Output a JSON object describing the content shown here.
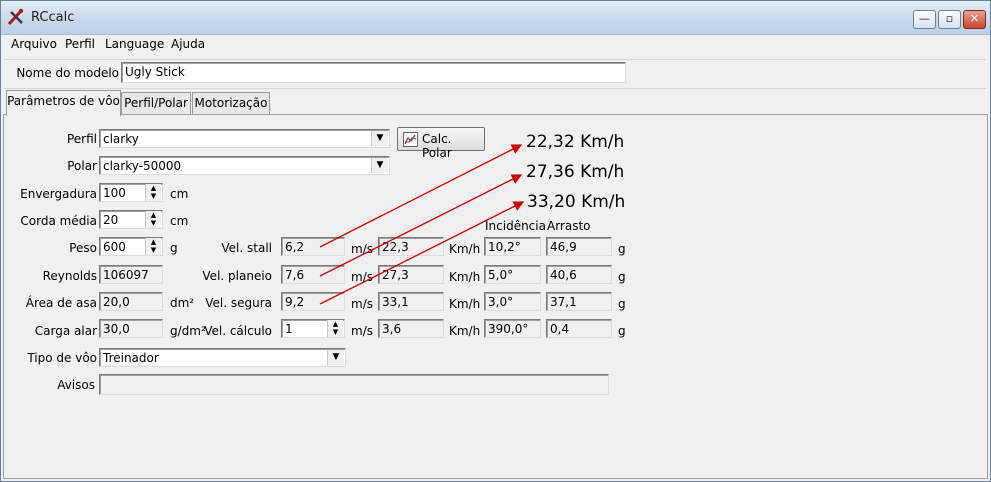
{
  "window": {
    "title": "RCcalc",
    "controls": {
      "minimize": "—",
      "maximize": "▫",
      "close": "✕"
    }
  },
  "menu": [
    "Arquivo",
    "Perfil",
    "Language",
    "Ajuda"
  ],
  "model": {
    "label": "Nome do modelo",
    "value": "Ugly Stick"
  },
  "tabs": [
    "Parâmetros de vôo",
    "Perfil/Polar",
    "Motorização"
  ],
  "form": {
    "perfil": {
      "label": "Perfil",
      "value": "clarky"
    },
    "polar": {
      "label": "Polar",
      "value": "clarky-50000"
    },
    "calc_polar_button": "Calc. Polar",
    "envergadura": {
      "label": "Envergadura",
      "value": "100",
      "unit": "cm"
    },
    "corda_media": {
      "label": "Corda média",
      "value": "20",
      "unit": "cm"
    },
    "peso": {
      "label": "Peso",
      "value": "600",
      "unit": "g"
    },
    "reynolds": {
      "label": "Reynolds",
      "value": "106097"
    },
    "area_asa": {
      "label": "Área de asa",
      "value": "20,0",
      "unit": "dm²"
    },
    "carga_alar": {
      "label": "Carga alar",
      "value": "30,0",
      "unit": "g/dm²"
    },
    "tipo_voo": {
      "label": "Tipo de vôo",
      "value": "Treinador"
    },
    "avisos": {
      "label": "Avisos",
      "value": ""
    }
  },
  "velocities": {
    "headers": {
      "incidencia": "Incidência",
      "arrasto": "Arrasto"
    },
    "units": {
      "ms": "m/s",
      "kmh": "Km/h",
      "g": "g"
    },
    "rows": [
      {
        "label": "Vel. stall",
        "ms": "6,2",
        "kmh": "22,3",
        "incidencia": "10,2°",
        "arrasto": "46,9"
      },
      {
        "label": "Vel. planeio",
        "ms": "7,6",
        "kmh": "27,3",
        "incidencia": "5,0°",
        "arrasto": "40,6"
      },
      {
        "label": "Vel. segura",
        "ms": "9,2",
        "kmh": "33,1",
        "incidencia": "3,0°",
        "arrasto": "37,1"
      },
      {
        "label": "Vel. cálculo",
        "ms": "1",
        "kmh": "3,6",
        "incidencia": "390,0°",
        "arrasto": "0,4"
      }
    ]
  },
  "annotations": [
    "22,32 Km/h",
    "27,36 Km/h",
    "33,20 Km/h"
  ],
  "colors": {
    "arrow": "#d40000",
    "titlebar": "#c8d9ea",
    "window_bg": "#f0f0f0"
  }
}
